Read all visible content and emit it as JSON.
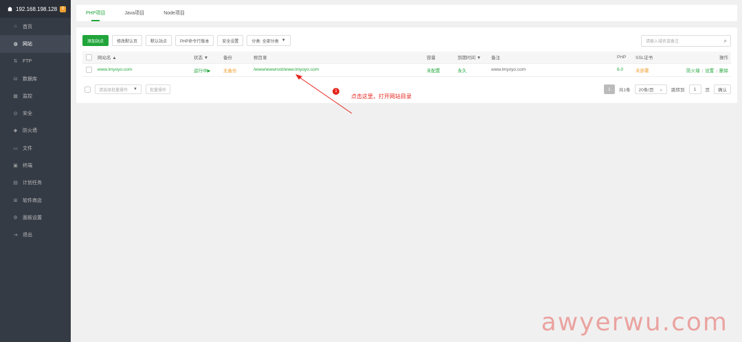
{
  "sidebar": {
    "server_ip": "192.168.198.128",
    "badge": "0",
    "items": [
      {
        "label": "首页",
        "icon": "home-icon",
        "glyph": "⌂"
      },
      {
        "label": "网站",
        "icon": "globe-icon",
        "glyph": "◍",
        "active": true
      },
      {
        "label": "FTP",
        "icon": "ftp-icon",
        "glyph": "⇅"
      },
      {
        "label": "数据库",
        "icon": "database-icon",
        "glyph": "⛁"
      },
      {
        "label": "监控",
        "icon": "monitor-icon",
        "glyph": "▦"
      },
      {
        "label": "安全",
        "icon": "shield-icon",
        "glyph": "◎"
      },
      {
        "label": "防火墙",
        "icon": "firewall-icon",
        "glyph": "◆"
      },
      {
        "label": "文件",
        "icon": "folder-icon",
        "glyph": "▭"
      },
      {
        "label": "终端",
        "icon": "terminal-icon",
        "glyph": "▣"
      },
      {
        "label": "计划任务",
        "icon": "calendar-icon",
        "glyph": "▤"
      },
      {
        "label": "软件商店",
        "icon": "apps-icon",
        "glyph": "⊞"
      },
      {
        "label": "面板设置",
        "icon": "gear-icon",
        "glyph": "⚙"
      },
      {
        "label": "退出",
        "icon": "logout-icon",
        "glyph": "⇥"
      }
    ]
  },
  "tabs": [
    {
      "label": "PHP项目",
      "active": true
    },
    {
      "label": "Java项目"
    },
    {
      "label": "Node项目"
    }
  ],
  "toolbar": {
    "add_site": "添加站点",
    "modify_default_page": "修改默认页",
    "default_site": "默认站点",
    "php_cli": "PHP命令行版本",
    "security_settings": "安全设置",
    "category": "分类: 全部分类"
  },
  "search": {
    "placeholder": "请输入域名或备注"
  },
  "table": {
    "headers": {
      "site_name": "网站名 ▲",
      "status": "状态 ▼",
      "backup": "备份",
      "root_dir": "根目录",
      "capacity": "容量",
      "expiry": "到期时间 ▼",
      "note": "备注",
      "php": "PHP",
      "ssl": "SSL证书",
      "actions": "操作"
    },
    "rows": [
      {
        "site": "www.lmyoyo.com",
        "status": "运行中▶",
        "backup": "无备份",
        "root_dir": "/www/wwwroot/www.lmyoyo.com",
        "capacity": "未配置",
        "expiry": "永久",
        "note": "www.lmyoyo.com",
        "php": "6.0",
        "ssl": "未部署",
        "action_firewall": "防火墙",
        "action_settings": "设置",
        "action_delete": "删除"
      }
    ]
  },
  "footer": {
    "batch_select": "请选择批量操作",
    "batch_button": "批量操作",
    "page_current": "1",
    "total": "共1条",
    "per_page": "20条/页",
    "goto_label": "跳转到",
    "goto_value": "1",
    "page_unit": "页",
    "confirm": "确认"
  },
  "annotation": {
    "number": "1",
    "text": "点击这里，打开网站目录",
    "color": "#e5251c"
  },
  "watermark": "awyerwu.com",
  "colors": {
    "accent": "#20a53a",
    "sidebar": "#353b45",
    "warning": "#f0a030"
  }
}
